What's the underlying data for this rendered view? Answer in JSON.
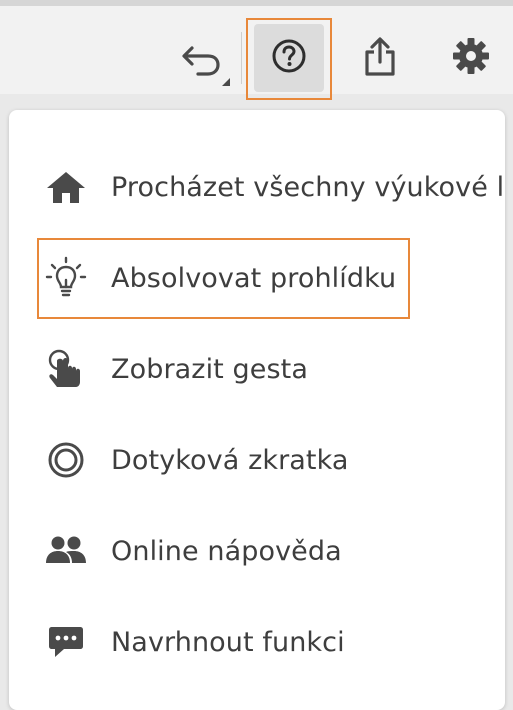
{
  "toolbar": {
    "undo_icon": "undo-icon",
    "help_icon": "help-circle-icon",
    "share_icon": "share-icon",
    "settings_icon": "gear-icon",
    "highlight_color": "#e8883a"
  },
  "menu": {
    "items": [
      {
        "icon": "home-icon",
        "label": "Procházet všechny výukové le"
      },
      {
        "icon": "lightbulb-icon",
        "label": "Absolvovat prohlídku"
      },
      {
        "icon": "touch-gesture-icon",
        "label": "Zobrazit gesta"
      },
      {
        "icon": "touch-shortcut-icon",
        "label": "Dotyková zkratka"
      },
      {
        "icon": "people-icon",
        "label": "Online nápověda"
      },
      {
        "icon": "speech-bubble-icon",
        "label": "Navrhnout funkci"
      }
    ]
  }
}
